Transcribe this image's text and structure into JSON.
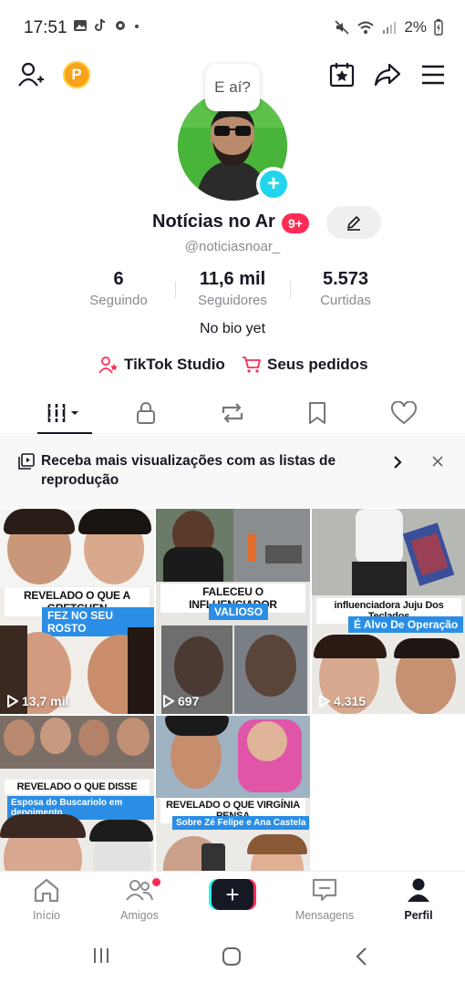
{
  "status_bar": {
    "time": "17:51",
    "battery": "2%"
  },
  "profile": {
    "bubble_text": "E aí?",
    "display_name": "Notícias no Ar",
    "notification_badge": "9+",
    "username": "@noticiasnoar_",
    "bio": "No bio yet"
  },
  "stats": [
    {
      "value": "6",
      "label": "Seguindo"
    },
    {
      "value": "11,6 mil",
      "label": "Seguidores"
    },
    {
      "value": "5.573",
      "label": "Curtidas"
    }
  ],
  "links": {
    "studio": "TikTok Studio",
    "orders": "Seus pedidos"
  },
  "promo": {
    "text": "Receba mais visualizações com as listas de reprodução"
  },
  "videos": [
    {
      "caption1": "REVELADO O QUE A GRETCHEN",
      "caption2": "FEZ NO SEU ROSTO",
      "views": "13,7 mil"
    },
    {
      "caption1": "FALECEU O INFLUENCIADOR",
      "caption2": "VALIOSO",
      "views": "697"
    },
    {
      "caption1": "influenciadora Juju Dos Teclados",
      "caption2": "É Alvo De Operação",
      "views": "4.315"
    },
    {
      "caption1": "REVELADO O QUE DISSE",
      "caption2": "Esposa do Buscariolo em depoimento",
      "views": ""
    },
    {
      "caption1": "REVELADO O QUE VIRGÍNIA PENSA",
      "caption2": "Sobre Zé Felipe e Ana Castela",
      "views": ""
    }
  ],
  "nav": {
    "home": "Início",
    "friends": "Amigos",
    "messages": "Mensagens",
    "profile": "Perfil"
  },
  "colors": {
    "accent": "#fe2c55",
    "cyan": "#20d5ec",
    "coin": "#f7a21b",
    "caption_blue": "#2b8ee6"
  },
  "icons": [
    "add-user-icon",
    "coin-icon",
    "calendar-star-icon",
    "share-icon",
    "menu-icon",
    "edit-icon",
    "grid-icon",
    "lock-icon",
    "repost-icon",
    "bookmark-icon",
    "heart-icon",
    "playlist-icon",
    "chevron-right-icon",
    "close-icon",
    "play-icon",
    "home-icon",
    "friends-icon",
    "create-icon",
    "messages-icon",
    "profile-icon"
  ]
}
